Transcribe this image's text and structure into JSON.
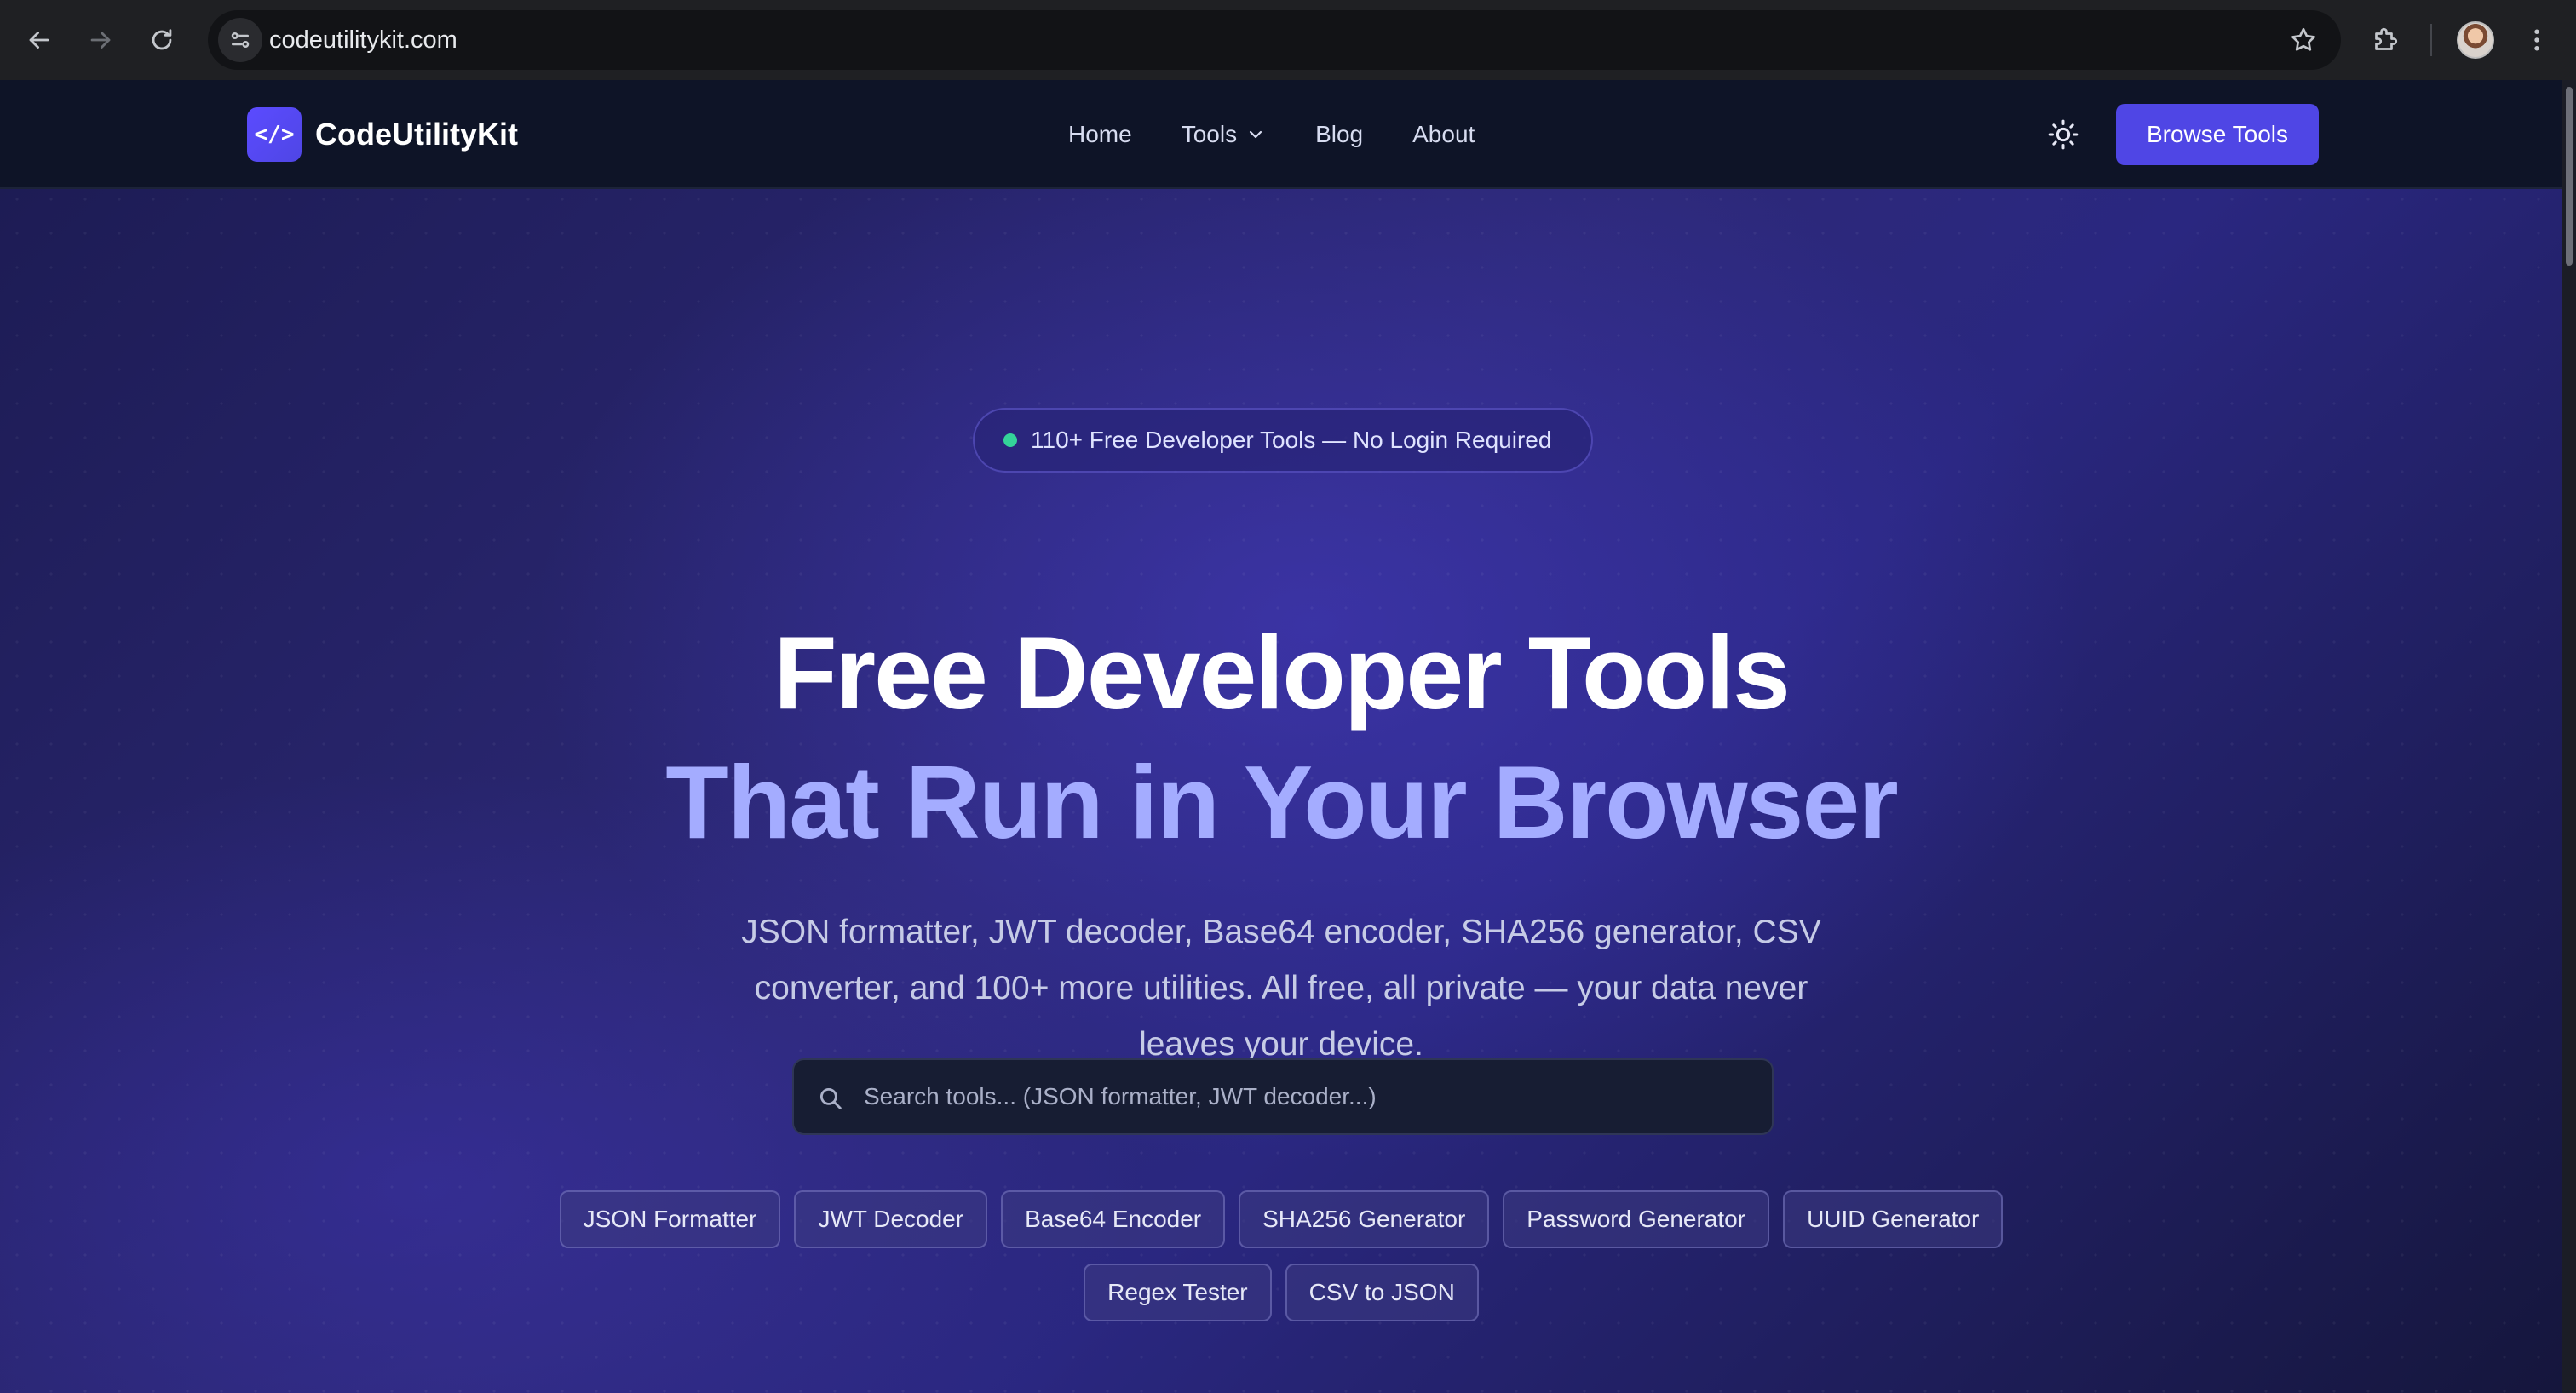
{
  "browser": {
    "url": "codeutilitykit.com",
    "icons": {
      "back": "arrow-left-icon",
      "forward": "arrow-right-icon",
      "reload": "reload-icon",
      "site_info": "tune-icon",
      "bookmark": "star-icon",
      "extensions": "puzzle-icon",
      "profile": "avatar",
      "menu": "kebab-icon"
    }
  },
  "site": {
    "logo_mark": "</>",
    "logo_text": "CodeUtilityKit",
    "nav": {
      "home": "Home",
      "tools": "Tools",
      "blog": "Blog",
      "about": "About"
    },
    "cta": "Browse Tools"
  },
  "hero": {
    "badge": "110+ Free Developer Tools — No Login Required",
    "title_line1": "Free Developer Tools",
    "title_line2": "That Run in Your Browser",
    "subtitle": "JSON formatter, JWT decoder, Base64 encoder, SHA256 generator, CSV converter, and 100+ more utilities. All free, all private — your data never leaves your device.",
    "search_placeholder": "Search tools... (JSON formatter, JWT decoder...)",
    "chips_row1": [
      "JSON Formatter",
      "JWT Decoder",
      "Base64 Encoder",
      "SHA256 Generator",
      "Password Generator",
      "UUID Generator"
    ],
    "chips_row2": [
      "Regex Tester",
      "CSV to JSON"
    ]
  },
  "colors": {
    "accent": "#4f46e5",
    "title_highlight": "#a4acff",
    "status_dot": "#34d399",
    "header_bg": "#0e1427"
  }
}
